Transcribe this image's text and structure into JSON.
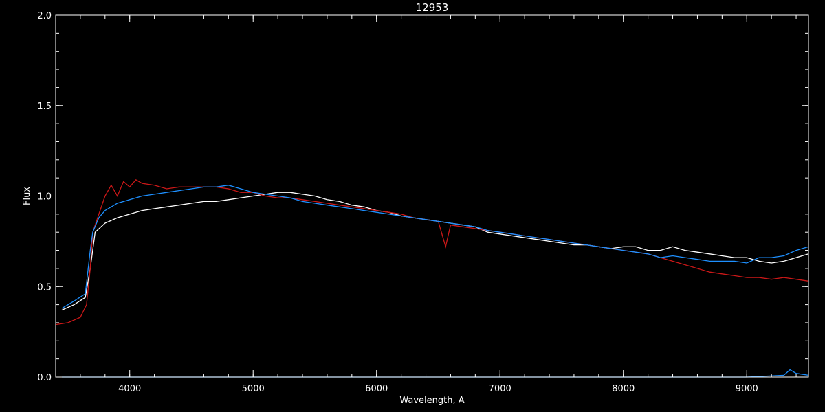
{
  "chart_data": {
    "type": "line",
    "title": "12953",
    "xlabel": "Wavelength, A",
    "ylabel": "Flux",
    "xlim": [
      3400,
      9500
    ],
    "ylim": [
      0.0,
      2.0
    ],
    "xticks": [
      4000,
      5000,
      6000,
      7000,
      8000,
      9000
    ],
    "yticks": [
      0.0,
      0.5,
      1.0,
      1.5,
      2.0
    ],
    "ytick_labels": [
      "0.0",
      "0.5",
      "1.0",
      "1.5",
      "2.0"
    ],
    "xtick_labels": [
      "4000",
      "5000",
      "6000",
      "7000",
      "8000",
      "9000"
    ],
    "grid": false,
    "series": [
      {
        "color": "#ffffff",
        "x": [
          3450,
          3550,
          3640,
          3680,
          3720,
          3800,
          3900,
          4000,
          4100,
          4200,
          4300,
          4400,
          4500,
          4600,
          4700,
          4800,
          4900,
          5000,
          5100,
          5200,
          5300,
          5400,
          5500,
          5600,
          5700,
          5800,
          5900,
          6000,
          6100,
          6200,
          6300,
          6400,
          6500,
          6600,
          6700,
          6800,
          6900,
          7000,
          7100,
          7200,
          7300,
          7400,
          7500,
          7600,
          7700,
          7800,
          7900,
          8000,
          8100,
          8200,
          8300,
          8400,
          8500,
          8600,
          8700,
          8800,
          8900,
          9000,
          9100,
          9200,
          9300,
          9400,
          9500
        ],
        "y": [
          0.37,
          0.4,
          0.44,
          0.6,
          0.8,
          0.85,
          0.88,
          0.9,
          0.92,
          0.93,
          0.94,
          0.95,
          0.96,
          0.97,
          0.97,
          0.98,
          0.99,
          1.0,
          1.01,
          1.02,
          1.02,
          1.01,
          1.0,
          0.98,
          0.97,
          0.95,
          0.94,
          0.92,
          0.91,
          0.89,
          0.88,
          0.87,
          0.86,
          0.85,
          0.84,
          0.83,
          0.8,
          0.79,
          0.78,
          0.77,
          0.76,
          0.75,
          0.74,
          0.73,
          0.73,
          0.72,
          0.71,
          0.72,
          0.72,
          0.7,
          0.7,
          0.72,
          0.7,
          0.69,
          0.68,
          0.67,
          0.66,
          0.66,
          0.64,
          0.63,
          0.64,
          0.66,
          0.68
        ]
      },
      {
        "color": "#cc1818",
        "x": [
          3400,
          3500,
          3600,
          3650,
          3680,
          3700,
          3750,
          3800,
          3850,
          3900,
          3950,
          4000,
          4050,
          4100,
          4200,
          4300,
          4400,
          4500,
          4600,
          4700,
          4800,
          4900,
          5000,
          5100,
          5200,
          5300,
          5400,
          5500,
          5600,
          5700,
          5800,
          5900,
          6000,
          6100,
          6200,
          6300,
          6400,
          6500,
          6560,
          6600,
          6700,
          6800,
          6900,
          7000,
          7100,
          7200,
          7300,
          7400,
          7500,
          7600,
          7700,
          7800,
          7900,
          8000,
          8100,
          8200,
          8300,
          8400,
          8500,
          8600,
          8700,
          8800,
          8900,
          9000,
          9100,
          9200,
          9300,
          9400,
          9500
        ],
        "y": [
          0.29,
          0.3,
          0.33,
          0.4,
          0.6,
          0.8,
          0.9,
          1.0,
          1.06,
          1.0,
          1.08,
          1.05,
          1.09,
          1.07,
          1.06,
          1.04,
          1.05,
          1.05,
          1.05,
          1.05,
          1.04,
          1.02,
          1.02,
          1.0,
          0.99,
          0.99,
          0.98,
          0.97,
          0.96,
          0.95,
          0.94,
          0.93,
          0.92,
          0.91,
          0.9,
          0.88,
          0.87,
          0.86,
          0.72,
          0.84,
          0.83,
          0.82,
          0.81,
          0.8,
          0.79,
          0.78,
          0.77,
          0.76,
          0.75,
          0.74,
          0.73,
          0.72,
          0.71,
          0.7,
          0.69,
          0.68,
          0.66,
          0.64,
          0.62,
          0.6,
          0.58,
          0.57,
          0.56,
          0.55,
          0.55,
          0.54,
          0.55,
          0.54,
          0.53
        ]
      },
      {
        "color": "#1e90ff",
        "x": [
          3450,
          3550,
          3640,
          3680,
          3700,
          3750,
          3800,
          3900,
          4000,
          4100,
          4200,
          4300,
          4400,
          4500,
          4600,
          4700,
          4800,
          4900,
          5000,
          5100,
          5200,
          5300,
          5400,
          5500,
          5600,
          5700,
          5800,
          5900,
          6000,
          6100,
          6200,
          6300,
          6400,
          6500,
          6600,
          6700,
          6800,
          6900,
          7000,
          7100,
          7200,
          7300,
          7400,
          7500,
          7600,
          7700,
          7800,
          7900,
          8000,
          8100,
          8200,
          8300,
          8400,
          8500,
          8600,
          8700,
          8800,
          8900,
          9000,
          9100,
          9200,
          9300,
          9400,
          9500
        ],
        "y": [
          0.38,
          0.42,
          0.46,
          0.7,
          0.8,
          0.88,
          0.92,
          0.96,
          0.98,
          1.0,
          1.01,
          1.02,
          1.03,
          1.04,
          1.05,
          1.05,
          1.06,
          1.04,
          1.02,
          1.01,
          1.0,
          0.99,
          0.97,
          0.96,
          0.95,
          0.94,
          0.93,
          0.92,
          0.91,
          0.9,
          0.89,
          0.88,
          0.87,
          0.86,
          0.85,
          0.84,
          0.83,
          0.81,
          0.8,
          0.79,
          0.78,
          0.77,
          0.76,
          0.75,
          0.74,
          0.73,
          0.72,
          0.71,
          0.7,
          0.69,
          0.68,
          0.66,
          0.67,
          0.66,
          0.65,
          0.64,
          0.64,
          0.64,
          0.63,
          0.66,
          0.66,
          0.67,
          0.7,
          0.72
        ]
      },
      {
        "color": "#1e90ff",
        "x": [
          3450,
          4000,
          5000,
          6000,
          7000,
          8000,
          9000,
          9300,
          9350,
          9400,
          9500
        ],
        "y": [
          0.0,
          0.0,
          0.0,
          0.0,
          0.0,
          0.0,
          0.0,
          0.01,
          0.04,
          0.02,
          0.01
        ]
      }
    ]
  }
}
